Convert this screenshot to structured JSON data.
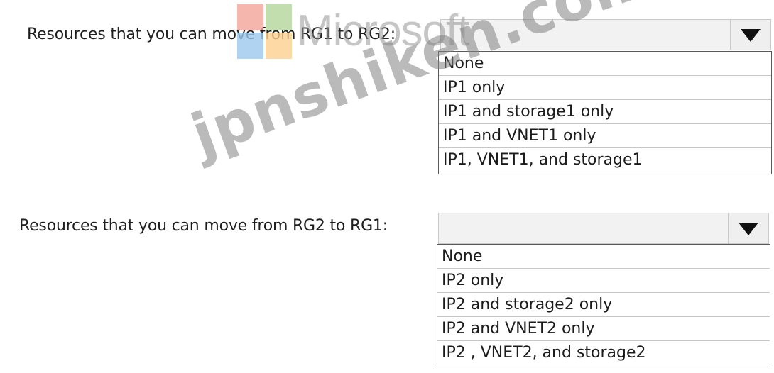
{
  "watermarks": {
    "brand_text": "Microsoft",
    "site_text": "jpnshiken.com"
  },
  "questions": [
    {
      "label": "Resources that you can move from RG1 to RG2:",
      "selected": "",
      "options": [
        "None",
        "IP1 only",
        "IP1 and storage1 only",
        "IP1 and VNET1 only",
        "IP1, VNET1, and storage1"
      ]
    },
    {
      "label": "Resources that you can move from RG2 to RG1:",
      "selected": "",
      "options": [
        "None",
        "IP2 only",
        "IP2 and storage2 only",
        "IP2 and VNET2 only",
        "IP2 , VNET2, and storage2"
      ]
    }
  ]
}
